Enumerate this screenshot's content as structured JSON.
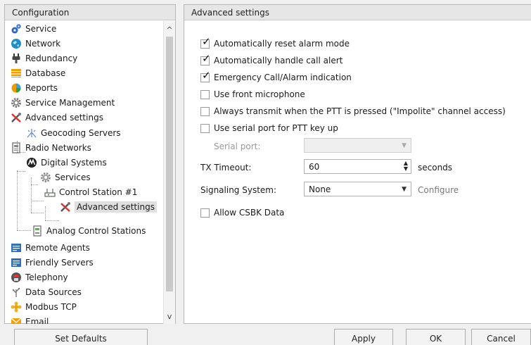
{
  "left_panel": {
    "title": "Configuration",
    "tree": [
      {
        "label": "Service",
        "icon": "service-gears-icon"
      },
      {
        "label": "Network",
        "icon": "network-globe-icon"
      },
      {
        "label": "Redundancy",
        "icon": "redundancy-plug-icon"
      },
      {
        "label": "Database",
        "icon": "database-icon"
      },
      {
        "label": "Reports",
        "icon": "reports-icon"
      },
      {
        "label": "Service Management",
        "icon": "service-management-gear-icon"
      },
      {
        "label": "Advanced settings",
        "icon": "advanced-settings-tools-icon"
      },
      {
        "label": "Geocoding Servers",
        "icon": "geocoding-icon"
      },
      {
        "label": "Radio Networks",
        "icon": "radio-networks-icon"
      },
      {
        "label": "Digital Systems",
        "icon": "motorola-logo-icon"
      },
      {
        "label": "Services",
        "icon": "services-gear-icon"
      },
      {
        "label": "Control Station #1",
        "icon": "control-station-icon"
      },
      {
        "label": "Advanced settings",
        "icon": "advanced-settings-tools-icon"
      },
      {
        "label": "Analog Control Stations",
        "icon": "analog-control-station-icon"
      },
      {
        "label": "Remote Agents",
        "icon": "remote-agents-icon"
      },
      {
        "label": "Friendly Servers",
        "icon": "friendly-servers-icon"
      },
      {
        "label": "Telephony",
        "icon": "telephony-icon"
      },
      {
        "label": "Data Sources",
        "icon": "data-sources-icon"
      },
      {
        "label": "Modbus TCP",
        "icon": "modbus-icon"
      },
      {
        "label": "Email",
        "icon": "email-icon"
      }
    ]
  },
  "right_panel": {
    "title": "Advanced settings",
    "checkboxes": [
      {
        "label": "Automatically reset alarm mode",
        "checked": true
      },
      {
        "label": "Automatically handle call alert",
        "checked": true
      },
      {
        "label": "Emergency Call/Alarm indication",
        "checked": true
      },
      {
        "label": "Use front microphone",
        "checked": false
      },
      {
        "label": "Always transmit when the PTT is pressed (\"Impolite\" channel access)",
        "checked": false
      },
      {
        "label": "Use serial port for PTT key up",
        "checked": false
      }
    ],
    "serial_port": {
      "label": "Serial port:",
      "value": ""
    },
    "tx_timeout": {
      "label": "TX Timeout:",
      "value": "60",
      "unit": "seconds"
    },
    "signaling": {
      "label": "Signaling System:",
      "value": "None",
      "configure": "Configure"
    },
    "csbk": {
      "label": "Allow CSBK Data",
      "checked": false
    }
  },
  "buttons": {
    "set_defaults": "Set Defaults",
    "apply": "Apply",
    "ok": "OK",
    "cancel": "Cancel"
  },
  "glyphs": {
    "check": "✓",
    "chevron_up": "^",
    "chevron_down": "v",
    "dropdown": "▼",
    "spin_up": "▲",
    "spin_down": "▼"
  }
}
